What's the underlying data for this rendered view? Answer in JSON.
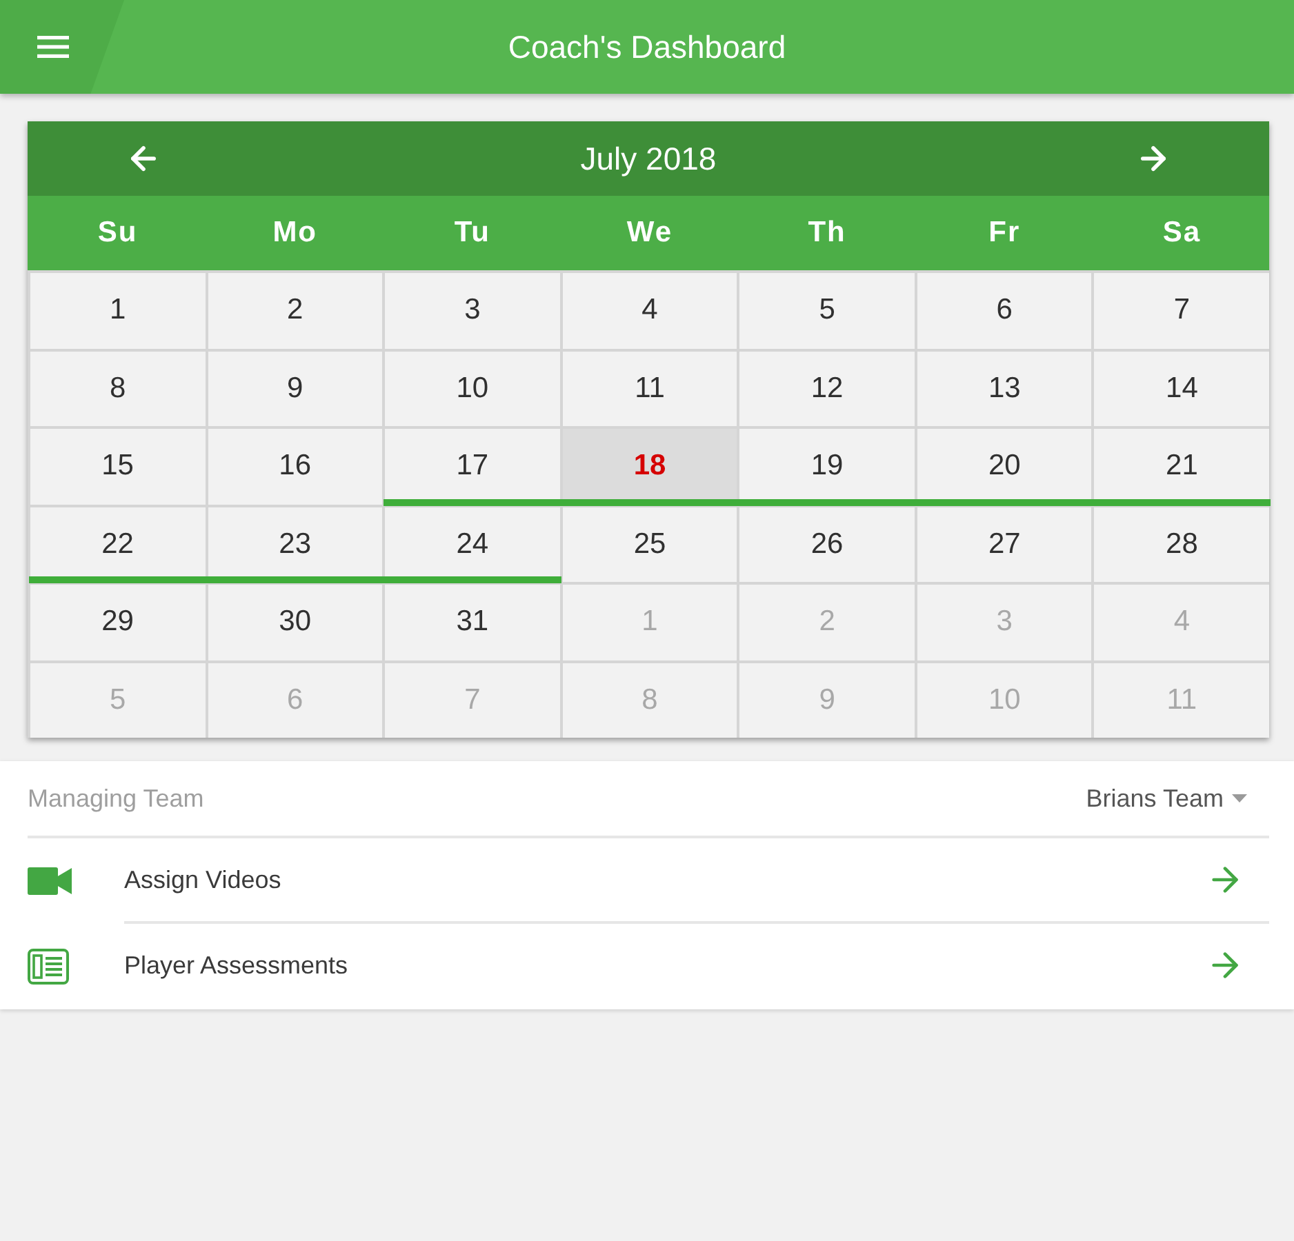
{
  "app_bar": {
    "title": "Coach's Dashboard"
  },
  "calendar": {
    "month": "July 2018",
    "weekdays": [
      "Su",
      "Mo",
      "Tu",
      "We",
      "Th",
      "Fr",
      "Sa"
    ],
    "days": [
      {
        "day": "1",
        "in_month": true,
        "today": false,
        "event": false
      },
      {
        "day": "2",
        "in_month": true,
        "today": false,
        "event": false
      },
      {
        "day": "3",
        "in_month": true,
        "today": false,
        "event": false
      },
      {
        "day": "4",
        "in_month": true,
        "today": false,
        "event": false
      },
      {
        "day": "5",
        "in_month": true,
        "today": false,
        "event": false
      },
      {
        "day": "6",
        "in_month": true,
        "today": false,
        "event": false
      },
      {
        "day": "7",
        "in_month": true,
        "today": false,
        "event": false
      },
      {
        "day": "8",
        "in_month": true,
        "today": false,
        "event": false
      },
      {
        "day": "9",
        "in_month": true,
        "today": false,
        "event": false
      },
      {
        "day": "10",
        "in_month": true,
        "today": false,
        "event": false
      },
      {
        "day": "11",
        "in_month": true,
        "today": false,
        "event": false
      },
      {
        "day": "12",
        "in_month": true,
        "today": false,
        "event": false
      },
      {
        "day": "13",
        "in_month": true,
        "today": false,
        "event": false
      },
      {
        "day": "14",
        "in_month": true,
        "today": false,
        "event": false
      },
      {
        "day": "15",
        "in_month": true,
        "today": false,
        "event": false
      },
      {
        "day": "16",
        "in_month": true,
        "today": false,
        "event": false
      },
      {
        "day": "17",
        "in_month": true,
        "today": false,
        "event": true
      },
      {
        "day": "18",
        "in_month": true,
        "today": true,
        "event": true
      },
      {
        "day": "19",
        "in_month": true,
        "today": false,
        "event": true
      },
      {
        "day": "20",
        "in_month": true,
        "today": false,
        "event": true
      },
      {
        "day": "21",
        "in_month": true,
        "today": false,
        "event": true
      },
      {
        "day": "22",
        "in_month": true,
        "today": false,
        "event": true
      },
      {
        "day": "23",
        "in_month": true,
        "today": false,
        "event": true
      },
      {
        "day": "24",
        "in_month": true,
        "today": false,
        "event": true
      },
      {
        "day": "25",
        "in_month": true,
        "today": false,
        "event": false
      },
      {
        "day": "26",
        "in_month": true,
        "today": false,
        "event": false
      },
      {
        "day": "27",
        "in_month": true,
        "today": false,
        "event": false
      },
      {
        "day": "28",
        "in_month": true,
        "today": false,
        "event": false
      },
      {
        "day": "29",
        "in_month": true,
        "today": false,
        "event": false
      },
      {
        "day": "30",
        "in_month": true,
        "today": false,
        "event": false
      },
      {
        "day": "31",
        "in_month": true,
        "today": false,
        "event": false
      },
      {
        "day": "1",
        "in_month": false,
        "today": false,
        "event": false
      },
      {
        "day": "2",
        "in_month": false,
        "today": false,
        "event": false
      },
      {
        "day": "3",
        "in_month": false,
        "today": false,
        "event": false
      },
      {
        "day": "4",
        "in_month": false,
        "today": false,
        "event": false
      },
      {
        "day": "5",
        "in_month": false,
        "today": false,
        "event": false
      },
      {
        "day": "6",
        "in_month": false,
        "today": false,
        "event": false
      },
      {
        "day": "7",
        "in_month": false,
        "today": false,
        "event": false
      },
      {
        "day": "8",
        "in_month": false,
        "today": false,
        "event": false
      },
      {
        "day": "9",
        "in_month": false,
        "today": false,
        "event": false
      },
      {
        "day": "10",
        "in_month": false,
        "today": false,
        "event": false
      },
      {
        "day": "11",
        "in_month": false,
        "today": false,
        "event": false
      }
    ]
  },
  "team": {
    "label": "Managing Team",
    "value": "Brians Team"
  },
  "menu": [
    {
      "label": "Assign Videos",
      "kind": "video"
    },
    {
      "label": "Player Assessments",
      "kind": "assessment"
    }
  ]
}
